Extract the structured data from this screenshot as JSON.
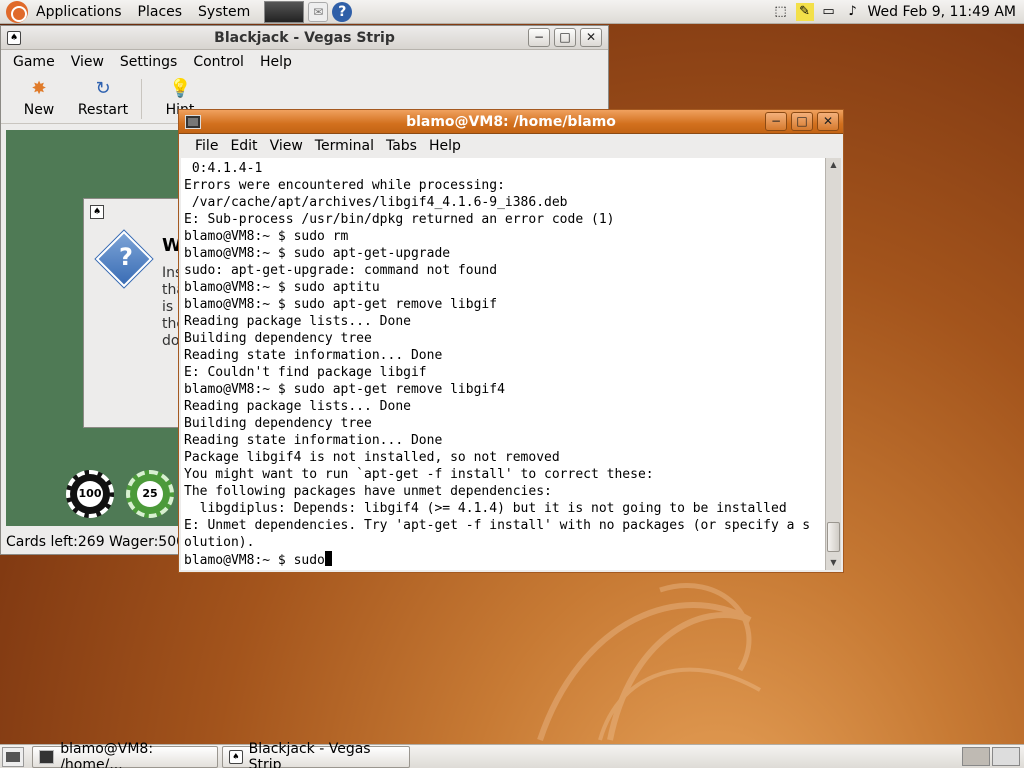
{
  "top_panel": {
    "menus": [
      "Applications",
      "Places",
      "System"
    ],
    "clock": "Wed Feb  9, 11:49 AM"
  },
  "blackjack": {
    "title": "Blackjack - Vegas Strip",
    "menus": [
      "Game",
      "View",
      "Settings",
      "Control",
      "Help"
    ],
    "toolbar": {
      "new": "New",
      "restart": "Restart",
      "hint": "Hint"
    },
    "dialog": {
      "title_partial": "W",
      "text_lines": [
        "Ins",
        "tha",
        "is c",
        "the",
        "do"
      ]
    },
    "chips": [
      "100",
      "25"
    ],
    "status": "Cards left:269  Wager:500"
  },
  "terminal": {
    "title": "blamo@VM8: /home/blamo",
    "menus": [
      "File",
      "Edit",
      "View",
      "Terminal",
      "Tabs",
      "Help"
    ],
    "lines": [
      " 0:4.1.4-1",
      "Errors were encountered while processing:",
      " /var/cache/apt/archives/libgif4_4.1.6-9_i386.deb",
      "E: Sub-process /usr/bin/dpkg returned an error code (1)",
      "blamo@VM8:~ $ sudo rm",
      "blamo@VM8:~ $ sudo apt-get-upgrade",
      "sudo: apt-get-upgrade: command not found",
      "blamo@VM8:~ $ sudo aptitu",
      "blamo@VM8:~ $ sudo apt-get remove libgif",
      "Reading package lists... Done",
      "Building dependency tree",
      "Reading state information... Done",
      "E: Couldn't find package libgif",
      "blamo@VM8:~ $ sudo apt-get remove libgif4",
      "Reading package lists... Done",
      "Building dependency tree",
      "Reading state information... Done",
      "Package libgif4 is not installed, so not removed",
      "You might want to run `apt-get -f install' to correct these:",
      "The following packages have unmet dependencies:",
      "  libgdiplus: Depends: libgif4 (>= 4.1.4) but it is not going to be installed",
      "E: Unmet dependencies. Try 'apt-get -f install' with no packages (or specify a s",
      "olution)."
    ],
    "prompt": "blamo@VM8:~ $ sudo"
  },
  "taskbar": {
    "tasks": [
      "blamo@VM8: /home/...",
      "Blackjack - Vegas Strip"
    ]
  }
}
